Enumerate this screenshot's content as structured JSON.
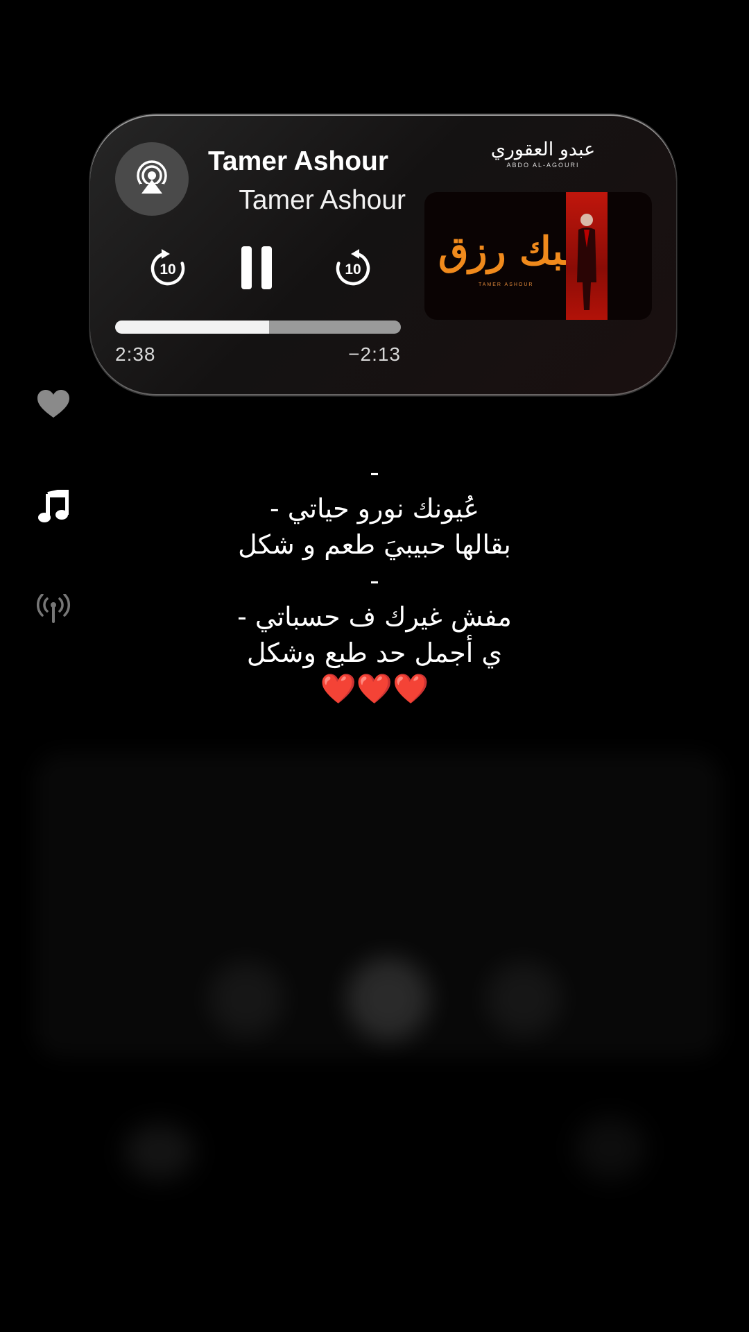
{
  "now_playing": {
    "title": "Tamer Ashour",
    "artist": "Tamer Ashour",
    "elapsed": "2:38",
    "remaining": "−2:13",
    "progress": 0.54
  },
  "brand": {
    "arabic": "عبدو العقوري",
    "english": "ABDO AL-AGOURI"
  },
  "artwork": {
    "title": "حبك رزق",
    "subtitle": "TAMER ASHOUR"
  },
  "icons": {
    "airplay": "airplay-icon",
    "skip_back": "skip-back-10-icon",
    "pause": "pause-icon",
    "skip_forward": "skip-forward-10-icon",
    "heart": "heart-icon",
    "music": "music-note-icon",
    "broadcast": "broadcast-icon"
  },
  "lyrics": {
    "lines": [
      "-",
      "- ﻋُﯿﻮﻧﻚ ﻧﻮﺭﻭ ﺣﯿﺎﺗﻲ",
      "ﺑﻘﺎﻟﻬﺎ ﺣﺒﯿﺒﻲَ ﻃﻌﻢ ﻭ ﺷﻜﻞ",
      "-",
      "- ﻣﻔﺶ ﻏﯿﺮﻙ ﻑ ﺣﺴﺒﺎﺗﻲ",
      "ﻱ ﺃﺟﻤﻞ ﺣﺪ ﻃﺒﻊ ﻭﺷﻜﻞ"
    ],
    "hearts": "❤️❤️❤️"
  },
  "colors": {
    "background": "#000000",
    "heart": "#e3202c",
    "art_title": "#f08a1c",
    "art_panel": "#c0160c"
  }
}
